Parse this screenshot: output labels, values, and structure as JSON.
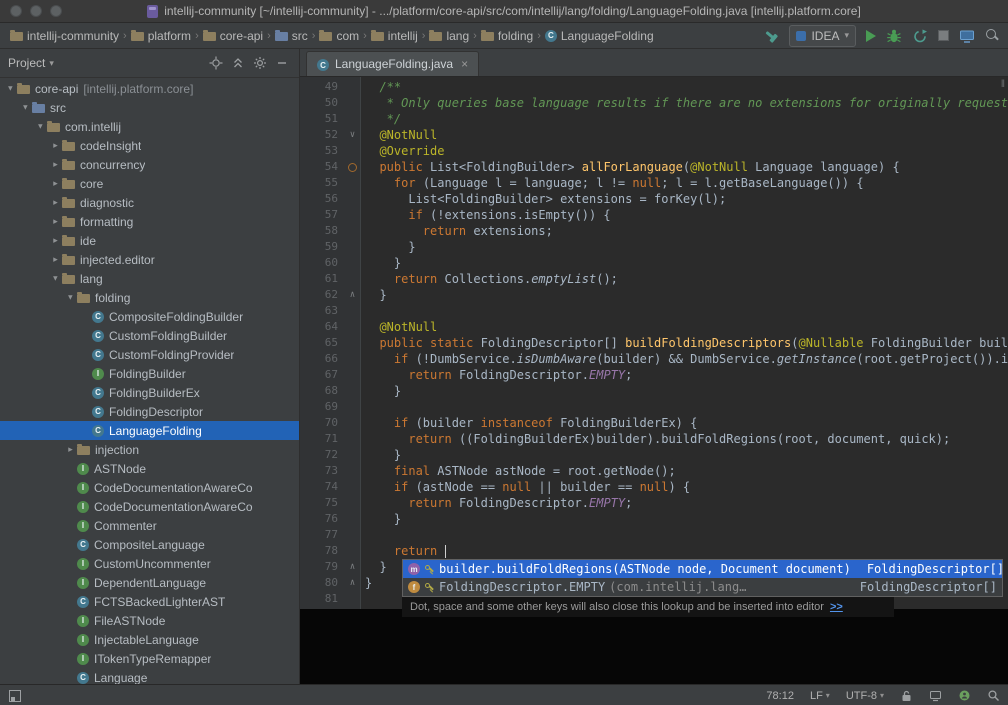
{
  "window": {
    "title": "intellij-community [~/intellij-community] - .../platform/core-api/src/com/intellij/lang/folding/LanguageFolding.java [intellij.platform.core]"
  },
  "navbar": {
    "breadcrumbs": [
      {
        "label": "intellij-community",
        "icon": "folder"
      },
      {
        "label": "platform",
        "icon": "folder"
      },
      {
        "label": "core-api",
        "icon": "folder"
      },
      {
        "label": "src",
        "icon": "folder-src"
      },
      {
        "label": "com",
        "icon": "package"
      },
      {
        "label": "intellij",
        "icon": "package"
      },
      {
        "label": "lang",
        "icon": "package"
      },
      {
        "label": "folding",
        "icon": "package"
      },
      {
        "label": "LanguageFolding",
        "icon": "class"
      }
    ],
    "run_config": "IDEA"
  },
  "project_panel": {
    "title": "Project",
    "tree": [
      {
        "label": "core-api",
        "qualifier": "[intellij.platform.core]",
        "level": 0,
        "icon": "module",
        "chevron": "open"
      },
      {
        "label": "src",
        "level": 1,
        "icon": "folder-src",
        "chevron": "open"
      },
      {
        "label": "com.intellij",
        "level": 2,
        "icon": "package",
        "chevron": "open"
      },
      {
        "label": "codeInsight",
        "level": 3,
        "icon": "package",
        "chevron": "closed"
      },
      {
        "label": "concurrency",
        "level": 3,
        "icon": "package",
        "chevron": "closed"
      },
      {
        "label": "core",
        "level": 3,
        "icon": "package",
        "chevron": "closed"
      },
      {
        "label": "diagnostic",
        "level": 3,
        "icon": "package",
        "chevron": "closed"
      },
      {
        "label": "formatting",
        "level": 3,
        "icon": "package",
        "chevron": "closed"
      },
      {
        "label": "ide",
        "level": 3,
        "icon": "package",
        "chevron": "closed"
      },
      {
        "label": "injected.editor",
        "level": 3,
        "icon": "package",
        "chevron": "closed"
      },
      {
        "label": "lang",
        "level": 3,
        "icon": "package",
        "chevron": "open"
      },
      {
        "label": "folding",
        "level": 4,
        "icon": "package",
        "chevron": "open"
      },
      {
        "label": "CompositeFoldingBuilder",
        "level": 5,
        "icon": "class"
      },
      {
        "label": "CustomFoldingBuilder",
        "level": 5,
        "icon": "class"
      },
      {
        "label": "CustomFoldingProvider",
        "level": 5,
        "icon": "class"
      },
      {
        "label": "FoldingBuilder",
        "level": 5,
        "icon": "interface"
      },
      {
        "label": "FoldingBuilderEx",
        "level": 5,
        "icon": "class"
      },
      {
        "label": "FoldingDescriptor",
        "level": 5,
        "icon": "class"
      },
      {
        "label": "LanguageFolding",
        "level": 5,
        "icon": "class",
        "selected": true
      },
      {
        "label": "injection",
        "level": 4,
        "icon": "package",
        "chevron": "closed"
      },
      {
        "label": "ASTNode",
        "level": 4,
        "icon": "interface"
      },
      {
        "label": "CodeDocumentationAwareCo",
        "level": 4,
        "icon": "interface"
      },
      {
        "label": "CodeDocumentationAwareCo",
        "level": 4,
        "icon": "interface"
      },
      {
        "label": "Commenter",
        "level": 4,
        "icon": "interface"
      },
      {
        "label": "CompositeLanguage",
        "level": 4,
        "icon": "class"
      },
      {
        "label": "CustomUncommenter",
        "level": 4,
        "icon": "interface"
      },
      {
        "label": "DependentLanguage",
        "level": 4,
        "icon": "interface"
      },
      {
        "label": "FCTSBackedLighterAST",
        "level": 4,
        "icon": "class"
      },
      {
        "label": "FileASTNode",
        "level": 4,
        "icon": "interface"
      },
      {
        "label": "InjectableLanguage",
        "level": 4,
        "icon": "interface"
      },
      {
        "label": "ITokenTypeRemapper",
        "level": 4,
        "icon": "interface"
      },
      {
        "label": "Language",
        "level": 4,
        "icon": "class"
      }
    ]
  },
  "editor": {
    "tab": {
      "label": "LanguageFolding.java"
    },
    "lines": [
      {
        "n": 49,
        "t": [
          [
            "cm",
            "  /**"
          ]
        ]
      },
      {
        "n": 50,
        "t": [
          [
            "cm",
            "   * Only queries base language results if there are no extensions for originally requested"
          ]
        ]
      },
      {
        "n": 51,
        "t": [
          [
            "cm",
            "   */"
          ]
        ]
      },
      {
        "n": 52,
        "mark": "down",
        "t": [
          [
            "ann",
            "  @NotNull"
          ]
        ]
      },
      {
        "n": 53,
        "t": [
          [
            "ann",
            "  @Override"
          ]
        ]
      },
      {
        "n": 54,
        "mark": "override",
        "t": [
          [
            "d",
            "  "
          ],
          [
            "k",
            "public"
          ],
          [
            "d",
            " List<FoldingBuilder> "
          ],
          [
            "m",
            "allForLanguage"
          ],
          [
            "d",
            "("
          ],
          [
            "ann",
            "@NotNull"
          ],
          [
            "d",
            " Language language) {"
          ]
        ]
      },
      {
        "n": 55,
        "t": [
          [
            "d",
            "    "
          ],
          [
            "k",
            "for"
          ],
          [
            "d",
            " (Language l = language; l != "
          ],
          [
            "k",
            "null"
          ],
          [
            "d",
            "; l = l.getBaseLanguage()) {"
          ]
        ]
      },
      {
        "n": 56,
        "t": [
          [
            "d",
            "      List<FoldingBuilder> extensions = forKey(l);"
          ]
        ]
      },
      {
        "n": 57,
        "t": [
          [
            "d",
            "      "
          ],
          [
            "k",
            "if"
          ],
          [
            "d",
            " (!extensions.isEmpty()) {"
          ]
        ]
      },
      {
        "n": 58,
        "t": [
          [
            "d",
            "        "
          ],
          [
            "k",
            "return"
          ],
          [
            "d",
            " extensions;"
          ]
        ]
      },
      {
        "n": 59,
        "t": [
          [
            "d",
            "      }"
          ]
        ]
      },
      {
        "n": 60,
        "t": [
          [
            "d",
            "    }"
          ]
        ]
      },
      {
        "n": 61,
        "t": [
          [
            "d",
            "    "
          ],
          [
            "k",
            "return"
          ],
          [
            "d",
            " Collections."
          ],
          [
            "it",
            "emptyList"
          ],
          [
            "d",
            "();"
          ]
        ]
      },
      {
        "n": 62,
        "mark": "up",
        "t": [
          [
            "d",
            "  }"
          ]
        ]
      },
      {
        "n": 63,
        "t": []
      },
      {
        "n": 64,
        "t": [
          [
            "ann",
            "  @NotNull"
          ]
        ]
      },
      {
        "n": 65,
        "t": [
          [
            "d",
            "  "
          ],
          [
            "k",
            "public static"
          ],
          [
            "d",
            " FoldingDescriptor[] "
          ],
          [
            "m",
            "buildFoldingDescriptors"
          ],
          [
            "d",
            "("
          ],
          [
            "ann",
            "@Nullable"
          ],
          [
            "d",
            " FoldingBuilder builder,"
          ]
        ]
      },
      {
        "n": 66,
        "t": [
          [
            "d",
            "    "
          ],
          [
            "k",
            "if"
          ],
          [
            "d",
            " (!DumbService."
          ],
          [
            "it",
            "isDumbAware"
          ],
          [
            "d",
            "(builder) && DumbService."
          ],
          [
            "it",
            "getInstance"
          ],
          [
            "d",
            "(root.getProject()).isDumbA"
          ]
        ]
      },
      {
        "n": 67,
        "t": [
          [
            "d",
            "      "
          ],
          [
            "k",
            "return"
          ],
          [
            "d",
            " FoldingDescriptor."
          ],
          [
            "fld",
            "EMPTY"
          ],
          [
            "d",
            ";"
          ]
        ]
      },
      {
        "n": 68,
        "t": [
          [
            "d",
            "    }"
          ]
        ]
      },
      {
        "n": 69,
        "t": []
      },
      {
        "n": 70,
        "t": [
          [
            "d",
            "    "
          ],
          [
            "k",
            "if"
          ],
          [
            "d",
            " (builder "
          ],
          [
            "k",
            "instanceof"
          ],
          [
            "d",
            " FoldingBuilderEx) {"
          ]
        ]
      },
      {
        "n": 71,
        "t": [
          [
            "d",
            "      "
          ],
          [
            "k",
            "return"
          ],
          [
            "d",
            " ((FoldingBuilderEx)builder).buildFoldRegions(root, document, quick);"
          ]
        ]
      },
      {
        "n": 72,
        "t": [
          [
            "d",
            "    }"
          ]
        ]
      },
      {
        "n": 73,
        "t": [
          [
            "d",
            "    "
          ],
          [
            "k",
            "final"
          ],
          [
            "d",
            " ASTNode astNode = root.getNode();"
          ]
        ]
      },
      {
        "n": 74,
        "t": [
          [
            "d",
            "    "
          ],
          [
            "k",
            "if"
          ],
          [
            "d",
            " (astNode == "
          ],
          [
            "k",
            "null"
          ],
          [
            "d",
            " || builder == "
          ],
          [
            "k",
            "null"
          ],
          [
            "d",
            ") {"
          ]
        ]
      },
      {
        "n": 75,
        "t": [
          [
            "d",
            "      "
          ],
          [
            "k",
            "return"
          ],
          [
            "d",
            " FoldingDescriptor."
          ],
          [
            "fld",
            "EMPTY"
          ],
          [
            "d",
            ";"
          ]
        ]
      },
      {
        "n": 76,
        "t": [
          [
            "d",
            "    }"
          ]
        ]
      },
      {
        "n": 77,
        "t": []
      },
      {
        "n": 78,
        "t": [
          [
            "d",
            "    "
          ],
          [
            "k",
            "return"
          ],
          [
            "d",
            " "
          ],
          [
            "caret",
            ""
          ]
        ]
      },
      {
        "n": 79,
        "mark": "up",
        "t": [
          [
            "d",
            "  }"
          ]
        ]
      },
      {
        "n": 80,
        "mark": "up",
        "t": [
          [
            "d",
            "}"
          ]
        ]
      },
      {
        "n": 81,
        "t": []
      }
    ]
  },
  "popup": {
    "items": [
      {
        "icon": "method",
        "text": "builder.buildFoldRegions(ASTNode node, Document document)",
        "type": "FoldingDescriptor[]",
        "selected": true
      },
      {
        "icon": "field",
        "text": "FoldingDescriptor.EMPTY",
        "tail": " (com.intellij.lang…",
        "type": "FoldingDescriptor[]",
        "selected": false
      }
    ],
    "hint": "Dot, space and some other keys will also close this lookup and be inserted into editor",
    "hint_link": ">>"
  },
  "status_bar": {
    "position": "78:12",
    "line_separator": "LF",
    "encoding": "UTF-8"
  }
}
